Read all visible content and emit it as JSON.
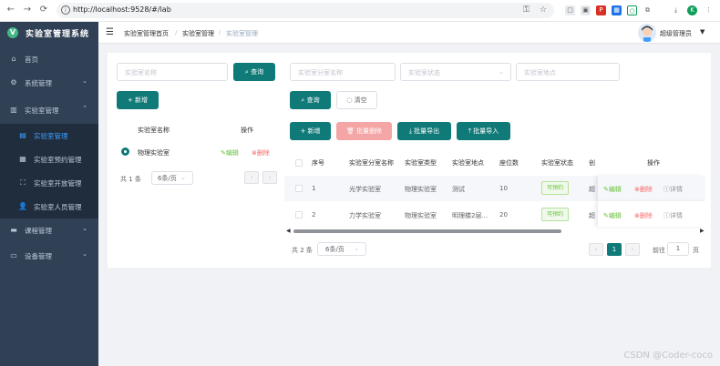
{
  "browser": {
    "url": "http://localhost:9528/#/lab",
    "back_icon": "←",
    "forward_icon": "→",
    "reload_icon": "⟳",
    "profile_initial": "K"
  },
  "sidebar": {
    "app_title": "实验室管理系统",
    "logo_letter": "V",
    "items": [
      {
        "label": "首页",
        "icon": "home-icon"
      },
      {
        "label": "系统管理",
        "icon": "gear-icon"
      },
      {
        "label": "实验室管理",
        "icon": "building-icon"
      },
      {
        "label": "课程管理",
        "icon": "book-icon"
      },
      {
        "label": "设备管理",
        "icon": "monitor-icon"
      }
    ],
    "subitems": [
      {
        "label": "实验室管理",
        "icon": "list-icon"
      },
      {
        "label": "实验室预约管理",
        "icon": "calendar-icon"
      },
      {
        "label": "实验室开放管理",
        "icon": "expand-icon"
      },
      {
        "label": "实验室人员管理",
        "icon": "user-icon"
      }
    ]
  },
  "header": {
    "breadcrumb": [
      "实验室管理首页",
      "实验室管理",
      "实验室管理"
    ],
    "separator": "/",
    "user_name": "超级管理员"
  },
  "left_panel": {
    "search_placeholder": "实验室名称",
    "search_button": "查询",
    "add_button": "新增",
    "columns": [
      "实验室名称",
      "操作"
    ],
    "rows": [
      {
        "name": "物理实验室",
        "edit": "编辑",
        "delete": "删除"
      }
    ],
    "total": "共 1 条",
    "page_size": "6条/页"
  },
  "right_panel": {
    "filters": {
      "name_placeholder": "实验室分室名称",
      "status_placeholder": "实验室状态",
      "location_placeholder": "实验室地点"
    },
    "query_button": "查询",
    "clear_button": "清空",
    "toolbar": {
      "add": "新增",
      "batch_delete": "批量删除",
      "batch_export": "批量导出",
      "batch_import": "批量导入"
    },
    "columns": [
      "序号",
      "实验室分室名称",
      "实验室类型",
      "实验室地点",
      "座位数",
      "实验室状态",
      "创",
      "操作"
    ],
    "rows": [
      {
        "index": "1",
        "name": "光学实验室",
        "type": "物理实验室",
        "location": "测试",
        "seats": "10",
        "status": "可预约",
        "creator": "超",
        "edit": "编辑",
        "delete": "删除",
        "detail": "详情"
      },
      {
        "index": "2",
        "name": "力学实验室",
        "type": "物理实验室",
        "location": "明理楼2层...",
        "seats": "20",
        "status": "可预约",
        "creator": "超",
        "edit": "编辑",
        "delete": "删除",
        "detail": "详情"
      }
    ],
    "total": "共 2 条",
    "page_size": "6条/页",
    "current_page": "1",
    "goto_label": "前往",
    "goto_value": "1",
    "page_unit": "页"
  },
  "watermark": "CSDN @Coder-coco"
}
